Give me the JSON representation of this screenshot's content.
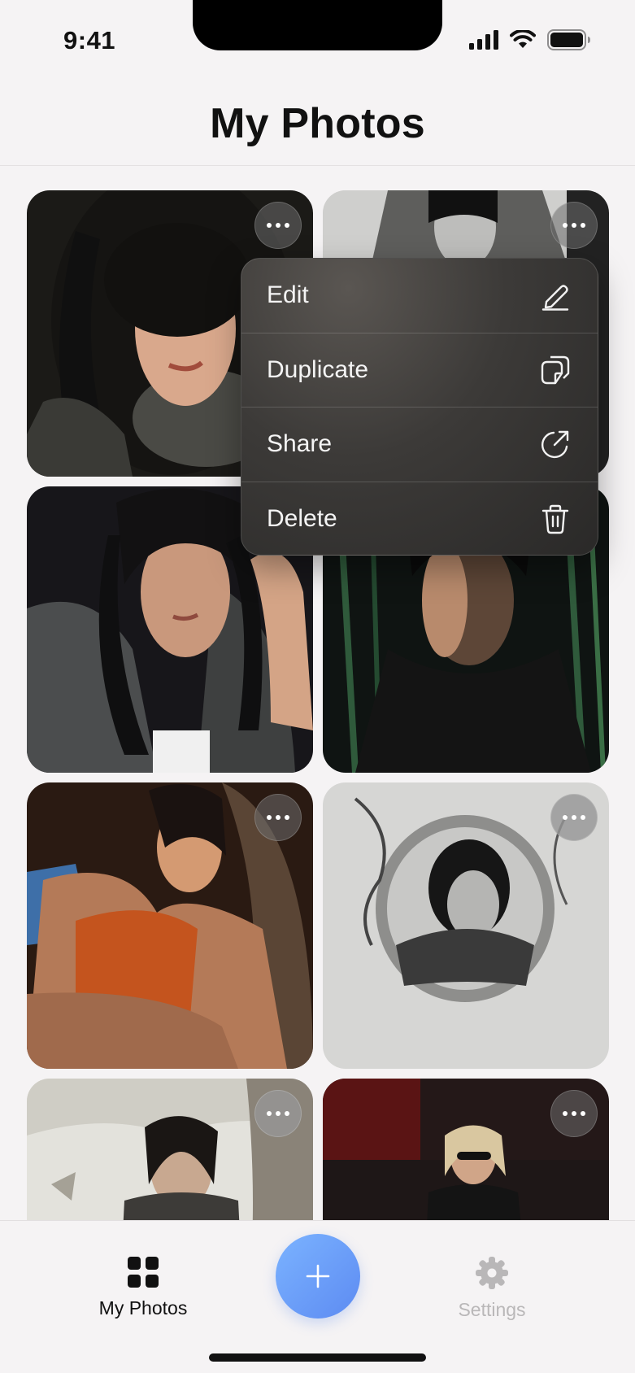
{
  "status_bar": {
    "time": "9:41"
  },
  "header": {
    "title": "My Photos"
  },
  "photos": [
    {
      "id": "p1",
      "tone": "dark"
    },
    {
      "id": "p2",
      "tone": "bw"
    },
    {
      "id": "p3",
      "tone": "dark"
    },
    {
      "id": "p4",
      "tone": "dark-green"
    },
    {
      "id": "p5",
      "tone": "warm"
    },
    {
      "id": "p6",
      "tone": "bw-light"
    },
    {
      "id": "p7",
      "tone": "pale"
    },
    {
      "id": "p8",
      "tone": "dark-red"
    }
  ],
  "context_menu": {
    "items": [
      {
        "label": "Edit",
        "icon": "pencil-icon"
      },
      {
        "label": "Duplicate",
        "icon": "duplicate-icon"
      },
      {
        "label": "Share",
        "icon": "share-icon"
      },
      {
        "label": "Delete",
        "icon": "trash-icon"
      }
    ]
  },
  "tab_bar": {
    "tabs": [
      {
        "label": "My Photos",
        "icon": "grid-icon",
        "active": true
      },
      {
        "label": "Settings",
        "icon": "gear-icon",
        "active": false
      }
    ],
    "add_icon": "plus-icon"
  },
  "colors": {
    "accent": "#6b9cf8",
    "background": "#f5f3f4",
    "menu_background": "#3a3836",
    "inactive_tab": "#b9b7b8"
  }
}
